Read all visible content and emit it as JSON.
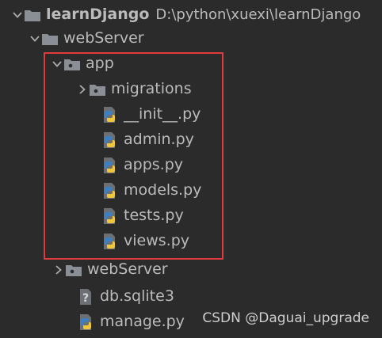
{
  "project": {
    "name": "learnDjango",
    "path": "D:\\python\\xuexi\\learnDjango"
  },
  "tree": {
    "webserver_outer": "webServer",
    "app": "app",
    "migrations": "migrations",
    "init_py": "__init__.py",
    "admin_py": "admin.py",
    "apps_py": "apps.py",
    "models_py": "models.py",
    "tests_py": "tests.py",
    "views_py": "views.py",
    "webserver_inner": "webServer",
    "db_sqlite3": "db.sqlite3",
    "manage_py": "manage.py"
  },
  "watermark": "CSDN @Daguai_upgrade",
  "colors": {
    "background": "#2b2b2b",
    "text": "#bbbbbb",
    "highlight_border": "#e03c3c",
    "folder": "#8a8f96",
    "python_blue": "#3f7fbf",
    "python_yellow": "#f0c73a"
  }
}
